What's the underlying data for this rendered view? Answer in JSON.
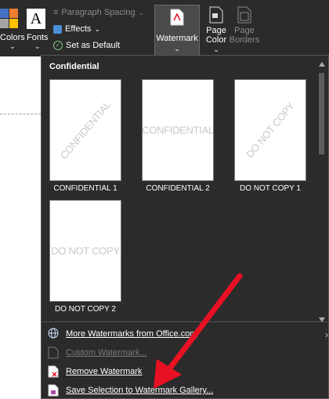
{
  "ribbon": {
    "colors_label": "Colors",
    "fonts_label": "Fonts",
    "fonts_glyph": "A",
    "paragraph_spacing_label": "Paragraph Spacing",
    "effects_label": "Effects",
    "set_default_label": "Set as Default",
    "watermark_label": "Watermark",
    "page_color_label_1": "Page",
    "page_color_label_2": "Color",
    "page_borders_label_1": "Page",
    "page_borders_label_2": "Borders"
  },
  "panel": {
    "section_title": "Confidential",
    "thumbnails": [
      {
        "text": "CONFIDENTIAL",
        "caption": "CONFIDENTIAL 1"
      },
      {
        "text": "CONFIDENTIAL",
        "caption": "CONFIDENTIAL 2"
      },
      {
        "text": "DO NOT COPY",
        "caption": "DO NOT COPY 1"
      },
      {
        "text": "DO NOT COPY",
        "caption": "DO NOT COPY 2"
      }
    ],
    "menu": {
      "more": "More Watermarks from Office.com",
      "custom": "Custom Watermark...",
      "remove": "Remove Watermark",
      "save": "Save Selection to Watermark Gallery..."
    }
  },
  "colors": {
    "accent_red": "#e81123",
    "watermark_gray": "#c9c9c9"
  }
}
